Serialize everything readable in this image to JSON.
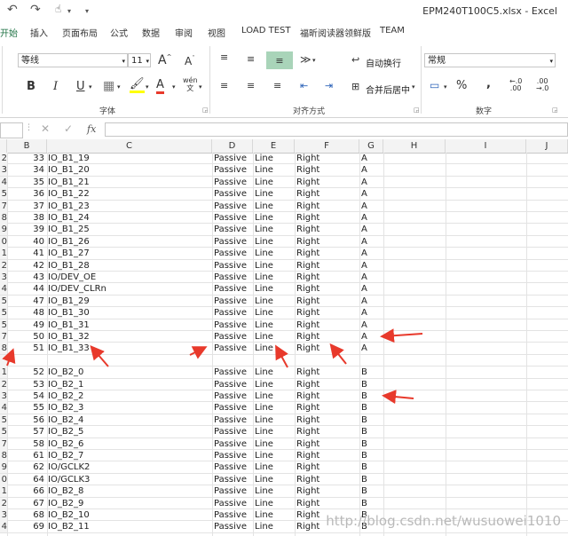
{
  "window": {
    "title": "EPM240T100C5.xlsx - Excel"
  },
  "ribbon_tabs": [
    "开始",
    "插入",
    "页面布局",
    "公式",
    "数据",
    "审阅",
    "视图",
    "LOAD TEST",
    "福昕阅读器领鲜版",
    "TEAM"
  ],
  "font_group": {
    "font_name": "等线",
    "font_size": "11",
    "label": "字体",
    "phonetic": "wén"
  },
  "align_group": {
    "wrap_text": "自动换行",
    "merge_center": "合并后居中",
    "label": "对齐方式"
  },
  "number_group": {
    "format": "常规",
    "label": "数字",
    "percent": "%",
    "comma": ","
  },
  "formula_bar": {
    "fx": "fx",
    "value": ""
  },
  "columns": [
    "B",
    "C",
    "D",
    "E",
    "F",
    "G",
    "H",
    "I",
    "J"
  ],
  "rows": [
    {
      "r": "2",
      "b": "33",
      "c": "IO_B1_19",
      "d": "Passive",
      "e": "Line",
      "f": "Right",
      "g": "A"
    },
    {
      "r": "3",
      "b": "34",
      "c": "IO_B1_20",
      "d": "Passive",
      "e": "Line",
      "f": "Right",
      "g": "A"
    },
    {
      "r": "4",
      "b": "35",
      "c": "IO_B1_21",
      "d": "Passive",
      "e": "Line",
      "f": "Right",
      "g": "A"
    },
    {
      "r": "5",
      "b": "36",
      "c": "IO_B1_22",
      "d": "Passive",
      "e": "Line",
      "f": "Right",
      "g": "A"
    },
    {
      "r": "7",
      "b": "37",
      "c": "IO_B1_23",
      "d": "Passive",
      "e": "Line",
      "f": "Right",
      "g": "A"
    },
    {
      "r": "8",
      "b": "38",
      "c": "IO_B1_24",
      "d": "Passive",
      "e": "Line",
      "f": "Right",
      "g": "A"
    },
    {
      "r": "9",
      "b": "39",
      "c": "IO_B1_25",
      "d": "Passive",
      "e": "Line",
      "f": "Right",
      "g": "A"
    },
    {
      "r": "0",
      "b": "40",
      "c": "IO_B1_26",
      "d": "Passive",
      "e": "Line",
      "f": "Right",
      "g": "A"
    },
    {
      "r": "1",
      "b": "41",
      "c": "IO_B1_27",
      "d": "Passive",
      "e": "Line",
      "f": "Right",
      "g": "A"
    },
    {
      "r": "2",
      "b": "42",
      "c": "IO_B1_28",
      "d": "Passive",
      "e": "Line",
      "f": "Right",
      "g": "A"
    },
    {
      "r": "3",
      "b": "43",
      "c": "IO/DEV_OE",
      "d": "Passive",
      "e": "Line",
      "f": "Right",
      "g": "A"
    },
    {
      "r": "4",
      "b": "44",
      "c": "IO/DEV_CLRn",
      "d": "Passive",
      "e": "Line",
      "f": "Right",
      "g": "A"
    },
    {
      "r": "5",
      "b": "47",
      "c": "IO_B1_29",
      "d": "Passive",
      "e": "Line",
      "f": "Right",
      "g": "A"
    },
    {
      "r": "5",
      "b": "48",
      "c": "IO_B1_30",
      "d": "Passive",
      "e": "Line",
      "f": "Right",
      "g": "A"
    },
    {
      "r": "5",
      "b": "49",
      "c": "IO_B1_31",
      "d": "Passive",
      "e": "Line",
      "f": "Right",
      "g": "A"
    },
    {
      "r": "7",
      "b": "50",
      "c": "IO_B1_32",
      "d": "Passive",
      "e": "Line",
      "f": "Right",
      "g": "A"
    },
    {
      "r": "8",
      "b": "51",
      "c": "IO_B1_33",
      "d": "Passive",
      "e": "Line",
      "f": "Right",
      "g": "A"
    },
    {
      "r": "",
      "b": "",
      "c": "",
      "d": "",
      "e": "",
      "f": "",
      "g": ""
    },
    {
      "r": "1",
      "b": "52",
      "c": "IO_B2_0",
      "d": "Passive",
      "e": "Line",
      "f": "Right",
      "g": "B"
    },
    {
      "r": "2",
      "b": "53",
      "c": "IO_B2_1",
      "d": "Passive",
      "e": "Line",
      "f": "Right",
      "g": "B"
    },
    {
      "r": "3",
      "b": "54",
      "c": "IO_B2_2",
      "d": "Passive",
      "e": "Line",
      "f": "Right",
      "g": "B"
    },
    {
      "r": "4",
      "b": "55",
      "c": "IO_B2_3",
      "d": "Passive",
      "e": "Line",
      "f": "Right",
      "g": "B"
    },
    {
      "r": "5",
      "b": "56",
      "c": "IO_B2_4",
      "d": "Passive",
      "e": "Line",
      "f": "Right",
      "g": "B"
    },
    {
      "r": "5",
      "b": "57",
      "c": "IO_B2_5",
      "d": "Passive",
      "e": "Line",
      "f": "Right",
      "g": "B"
    },
    {
      "r": "7",
      "b": "58",
      "c": "IO_B2_6",
      "d": "Passive",
      "e": "Line",
      "f": "Right",
      "g": "B"
    },
    {
      "r": "8",
      "b": "61",
      "c": "IO_B2_7",
      "d": "Passive",
      "e": "Line",
      "f": "Right",
      "g": "B"
    },
    {
      "r": "9",
      "b": "62",
      "c": "IO/GCLK2",
      "d": "Passive",
      "e": "Line",
      "f": "Right",
      "g": "B"
    },
    {
      "r": "0",
      "b": "64",
      "c": "IO/GCLK3",
      "d": "Passive",
      "e": "Line",
      "f": "Right",
      "g": "B"
    },
    {
      "r": "1",
      "b": "66",
      "c": "IO_B2_8",
      "d": "Passive",
      "e": "Line",
      "f": "Right",
      "g": "B"
    },
    {
      "r": "2",
      "b": "67",
      "c": "IO_B2_9",
      "d": "Passive",
      "e": "Line",
      "f": "Right",
      "g": "B"
    },
    {
      "r": "3",
      "b": "68",
      "c": "IO_B2_10",
      "d": "Passive",
      "e": "Line",
      "f": "Right",
      "g": "B"
    },
    {
      "r": "4",
      "b": "69",
      "c": "IO_B2_11",
      "d": "Passive",
      "e": "Line",
      "f": "Right",
      "g": "B"
    }
  ],
  "watermark": "http://blog.csdn.net/wusuowei1010",
  "colors": {
    "accent": "#217346",
    "arrow": "#e8392b",
    "highlight": "#a9d4b9"
  }
}
